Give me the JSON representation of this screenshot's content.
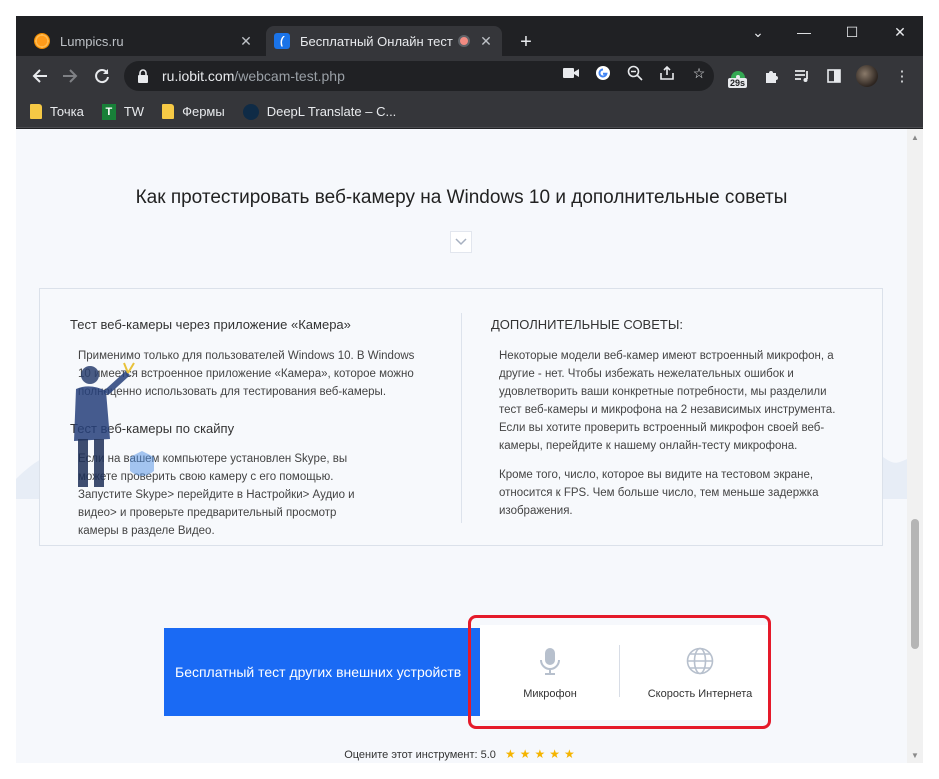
{
  "browser": {
    "tabs": [
      {
        "title": "Lumpics.ru",
        "active": false,
        "favicon": "orange-favicon"
      },
      {
        "title": "Бесплатный Онлайн тест веб",
        "active": true,
        "favicon": "iobit-favicon",
        "recording": true
      }
    ],
    "new_tab_glyph": "+",
    "window_controls": {
      "dropdown": "⌄",
      "minimize": "—",
      "maximize": "☐",
      "close": "✕"
    }
  },
  "toolbar": {
    "url_host": "ru.iobit.com",
    "url_path": "/webcam-test.php",
    "extension_badge": "29s"
  },
  "bookmarks": [
    {
      "label": "Точка",
      "icon": "folder-icon"
    },
    {
      "label": "TW",
      "icon": "tw-icon"
    },
    {
      "label": "Фермы",
      "icon": "folder-icon"
    },
    {
      "label": "DeepL Translate – C...",
      "icon": "deepl-icon"
    }
  ],
  "page": {
    "section_title": "Как протестировать веб-камеру на Windows 10 и дополнительные советы",
    "left_column": {
      "heading1": "Тест веб-камеры через приложение «Камера»",
      "text1": "Применимо только для пользователей Windows 10. В Windows 10 имеется встроенное приложение «Камера», которое можно полноценно использовать для тестирования веб-камеры.",
      "heading2": "Тест веб-камеры по скайпу",
      "text2": "Если на вашем компьютере установлен Skype, вы можете проверить свою камеру с его помощью. Запустите Skype> перейдите в Настройки> Аудио и видео> и проверьте предварительный просмотр камеры в разделе Видео."
    },
    "right_column": {
      "heading": "ДОПОЛНИТЕЛЬНЫЕ СОВЕТЫ:",
      "text1": "Некоторые модели веб-камер имеют встроенный микрофон, а другие - нет. Чтобы избежать нежелательных ошибок и удовлетворить ваши конкретные потребности, мы разделили тест веб-камеры и микрофона на 2 независимых инструмента. Если вы хотите проверить встроенный микрофон своей веб-камеры, перейдите к нашему онлайн-тесту микрофона.",
      "text2": "Кроме того, число, которое вы видите на тестовом экране, относится к FPS. Чем больше число, тем меньше задержка изображения."
    },
    "cta_label": "Бесплатный тест других внешних устройств",
    "tools": [
      {
        "label": "Микрофон",
        "icon": "microphone-icon"
      },
      {
        "label": "Скорость Интернета",
        "icon": "globe-icon"
      }
    ],
    "rating_text": "Оцените этот инструмент: 5.0",
    "rating_stars": "★★★★★",
    "rating_value": 5.0
  },
  "colors": {
    "cta_blue": "#1a6af4",
    "highlight_red": "#e51a2a",
    "star_gold": "#f5b400"
  }
}
